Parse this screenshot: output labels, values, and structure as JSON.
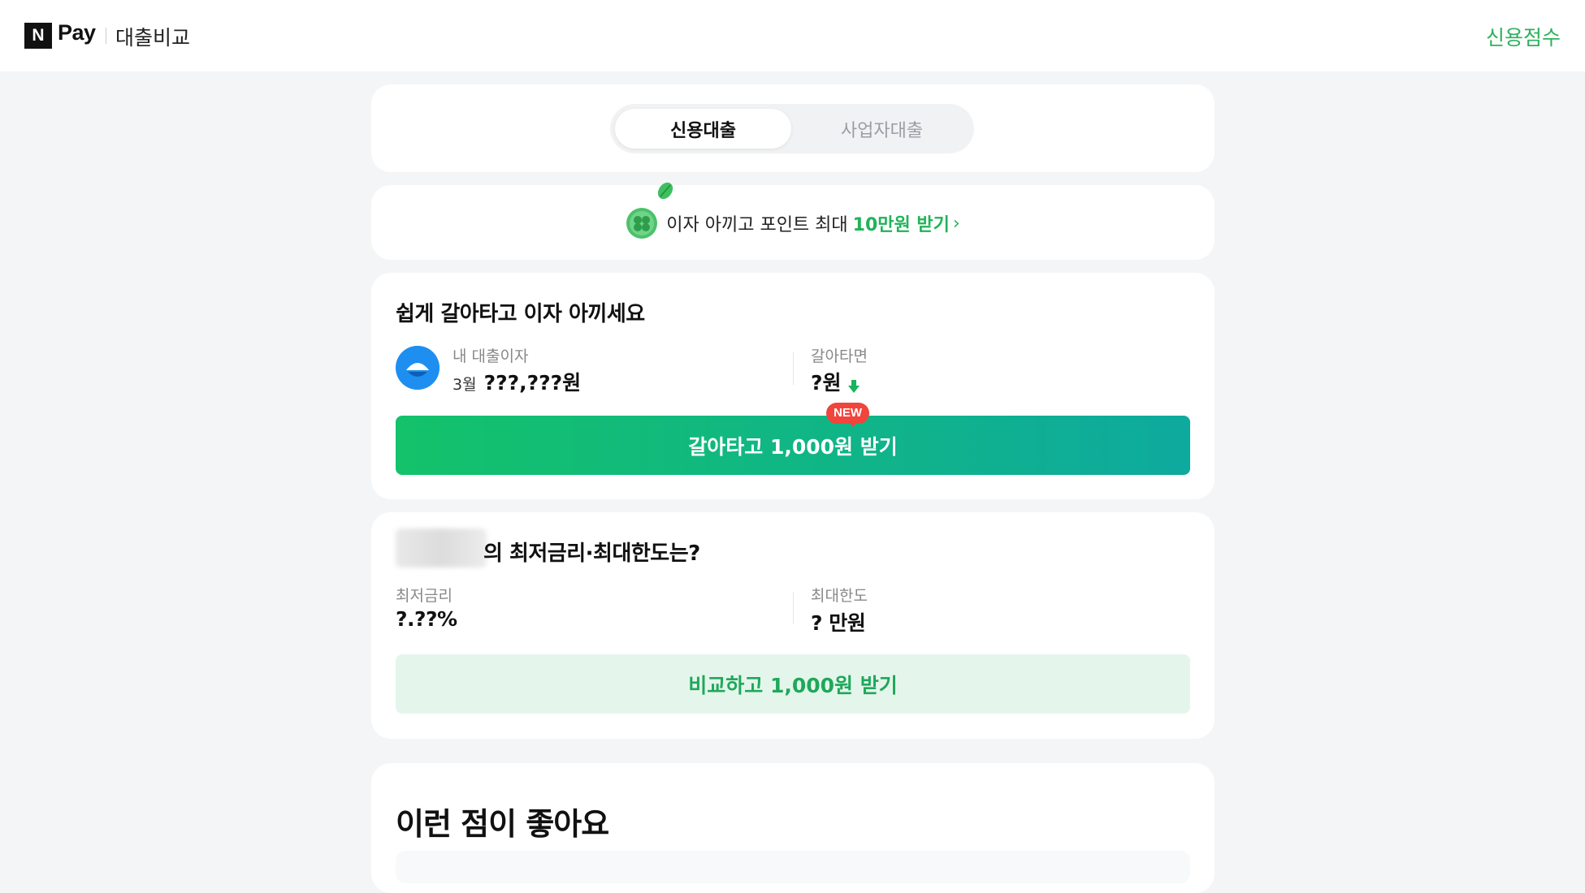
{
  "header": {
    "logo_letter": "N",
    "logo_brand": "Pay",
    "service_name": "대출비교",
    "credit_score_link": "신용점수"
  },
  "tabs": {
    "items": [
      {
        "label": "신용대출",
        "active": true
      },
      {
        "label": "사업자대출",
        "active": false
      }
    ]
  },
  "promo": {
    "text": "이자 아끼고 포인트 최대",
    "highlight": "10만원 받기",
    "arrow": "›"
  },
  "refinance": {
    "title": "쉽게 갈아타고 이자 아끼세요",
    "my_interest_label": "내 대출이자",
    "my_interest_month": "3월",
    "my_interest_value": "???,???원",
    "switch_label": "갈아타면",
    "switch_value": "?원",
    "button_label": "갈아타고 1,000원 받기",
    "badge": "NEW"
  },
  "compare": {
    "title_suffix": "의 최저금리·최대한도는?",
    "min_rate_label": "최저금리",
    "min_rate_value": "?.??%",
    "max_limit_label": "최대한도",
    "max_limit_value": "? 만원",
    "button_label": "비교하고 1,000원 받기"
  },
  "benefits": {
    "title": "이런 점이 좋아요"
  },
  "colors": {
    "brand_green": "#1fb358",
    "badge_red": "#f0443c",
    "bank_blue": "#1e8ff0"
  }
}
